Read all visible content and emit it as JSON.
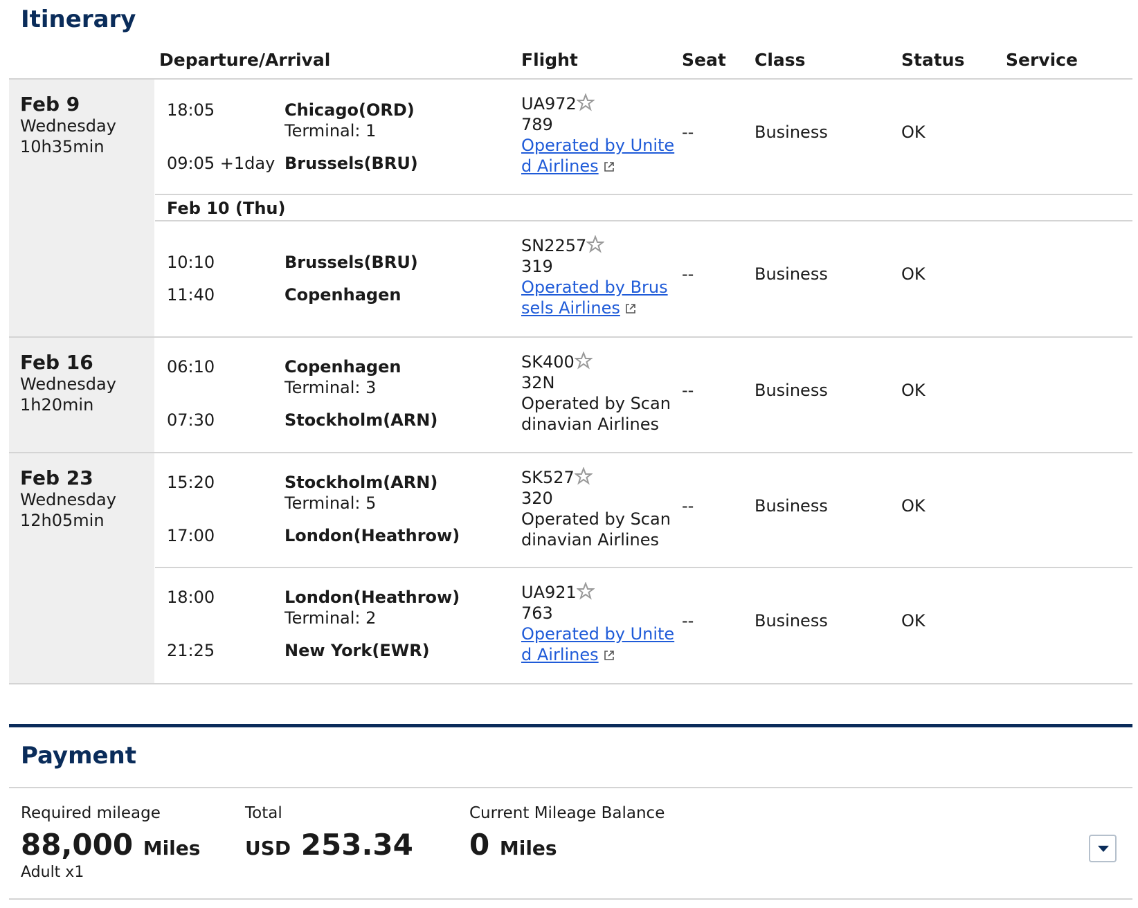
{
  "itinerary": {
    "title": "Itinerary",
    "columns": {
      "departure_arrival": "Departure/Arrival",
      "flight": "Flight",
      "seat": "Seat",
      "class": "Class",
      "status": "Status",
      "service": "Service"
    },
    "groups": [
      {
        "date": "Feb 9",
        "weekday": "Wednesday",
        "duration": "10h35min"
      },
      {
        "date": "Feb 16",
        "weekday": "Wednesday",
        "duration": "1h20min"
      },
      {
        "date": "Feb 23",
        "weekday": "Wednesday",
        "duration": "12h05min"
      }
    ],
    "subdate": "Feb 10 (Thu)",
    "segments": [
      {
        "dep_time": "18:05",
        "dep_city": "Chicago(ORD)",
        "dep_terminal": "Terminal: 1",
        "arr_time": "09:05 +1day",
        "arr_city": "Brussels(BRU)",
        "flight_no": "UA972",
        "aircraft": "789",
        "operator_line1": "Operated by Unite",
        "operator_line2": "d Airlines",
        "seat": "--",
        "class": "Business",
        "status": "OK"
      },
      {
        "dep_time": "10:10",
        "dep_city": "Brussels(BRU)",
        "arr_time": "11:40",
        "arr_city": "Copenhagen",
        "flight_no": "SN2257",
        "aircraft": "319",
        "operator_line1": "Operated by Brus",
        "operator_line2": "sels Airlines",
        "seat": "--",
        "class": "Business",
        "status": "OK"
      },
      {
        "dep_time": "06:10",
        "dep_city": "Copenhagen",
        "dep_terminal": "Terminal: 3",
        "arr_time": "07:30",
        "arr_city": "Stockholm(ARN)",
        "flight_no": "SK400",
        "aircraft": "32N",
        "operator_line1": "Operated by Scan",
        "operator_line2": "dinavian Airlines",
        "seat": "--",
        "class": "Business",
        "status": "OK"
      },
      {
        "dep_time": "15:20",
        "dep_city": "Stockholm(ARN)",
        "dep_terminal": "Terminal: 5",
        "arr_time": "17:00",
        "arr_city": "London(Heathrow)",
        "flight_no": "SK527",
        "aircraft": "320",
        "operator_line1": "Operated by Scan",
        "operator_line2": "dinavian Airlines",
        "seat": "--",
        "class": "Business",
        "status": "OK"
      },
      {
        "dep_time": "18:00",
        "dep_city": "London(Heathrow)",
        "dep_terminal": "Terminal: 2",
        "arr_time": "21:25",
        "arr_city": "New York(EWR)",
        "flight_no": "UA921",
        "aircraft": "763",
        "operator_line1": "Operated by Unite",
        "operator_line2": "d Airlines",
        "seat": "--",
        "class": "Business",
        "status": "OK"
      }
    ]
  },
  "payment": {
    "title": "Payment",
    "required_label": "Required mileage",
    "required_value": "88,000",
    "required_unit": "Miles",
    "passengers": "Adult x1",
    "total_label": "Total",
    "total_currency": "USD",
    "total_value": "253.34",
    "balance_label": "Current Mileage Balance",
    "balance_value": "0",
    "balance_unit": "Miles"
  },
  "colors": {
    "navy": "#0a2c5a",
    "link": "#1f5bd8",
    "date_column_bg": "#efefef",
    "divider": "#d4d4d4"
  },
  "icons": {
    "star_alliance": "star-alliance-icon",
    "external_link": "external-link-icon",
    "dropdown": "chevron-down-icon"
  }
}
